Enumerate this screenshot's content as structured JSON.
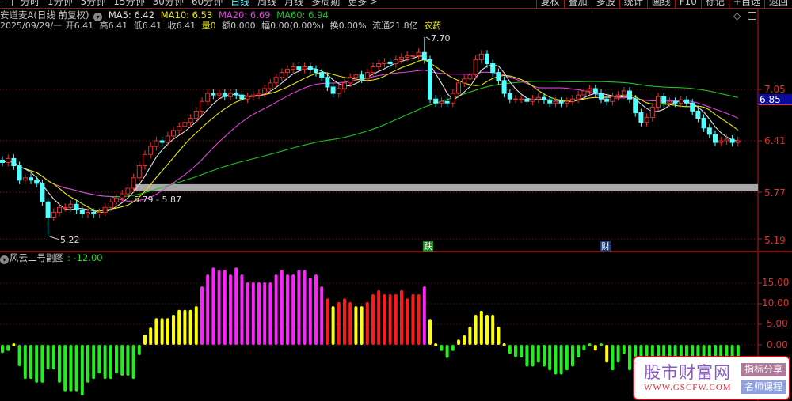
{
  "toolbar": {
    "periods": [
      "分时",
      "1分钟",
      "5分钟",
      "15分钟",
      "30分钟",
      "60分钟",
      "日线",
      "周线",
      "月线",
      "多周期",
      "更多 >"
    ],
    "active_index": 6,
    "buttons": [
      "复权",
      "叠加",
      "多股",
      "统计",
      "画线",
      "F10",
      "标记",
      "+自选",
      "返回"
    ]
  },
  "header": {
    "title": "安道麦A(日线 前复权)",
    "ma5": "MA5: 6.42",
    "ma10": "MA10: 6.53",
    "ma20": "MA20: 6.69",
    "ma60": "MA60: 6.94",
    "date": "2025/09/29/一",
    "open": "开6.41",
    "high": "高6.41",
    "low": "低6.41",
    "close": "收6.41",
    "volume": "量0",
    "amount": "额0.000",
    "range": "幅0.00(0.00%)",
    "turnover": "换0.00%",
    "float": "流通21.8亿",
    "sector": "农药"
  },
  "axis": {
    "price_labels": [
      "7.05",
      "6.41",
      "5.77",
      "5.19"
    ],
    "current_price": "6.85",
    "ind_labels": [
      "15.00",
      "10.00",
      "5.00",
      "0.00"
    ]
  },
  "marks": {
    "high": "7.70",
    "low": "5.22",
    "band": "5.79 - 5.87",
    "down_tag": "跌",
    "fin_tag": "财"
  },
  "sub": {
    "title": "风云二号副图",
    "value": ": -12.00"
  },
  "watermark": {
    "name": "股市财富网",
    "url": "WWW.GSCFW.COM",
    "btn1": "指标分享",
    "btn2": "名师课程"
  },
  "colors": {
    "up": "#e83030",
    "down": "#54ffff",
    "ma5": "#e0e0e0",
    "ma10": "#e8e800",
    "ma20": "#e040e0",
    "ma60": "#20c020",
    "ind_g": "#22ee22",
    "ind_y": "#ffff00",
    "ind_m": "#ff22ff",
    "ind_r": "#ff1a1a"
  },
  "chart_data": {
    "type": "candlestick",
    "ylim": [
      5.1,
      7.75
    ],
    "band": [
      5.79,
      5.87
    ],
    "high_point": {
      "index": 74,
      "value": 7.7
    },
    "low_point": {
      "index": 8,
      "value": 5.22
    },
    "closes": [
      6.14,
      6.19,
      6.1,
      5.92,
      5.95,
      5.92,
      5.88,
      5.65,
      5.46,
      5.52,
      5.58,
      5.58,
      5.62,
      5.55,
      5.5,
      5.52,
      5.5,
      5.52,
      5.58,
      5.65,
      5.7,
      5.75,
      5.82,
      5.95,
      6.1,
      6.24,
      6.34,
      6.41,
      6.39,
      6.47,
      6.54,
      6.59,
      6.64,
      6.69,
      6.78,
      6.9,
      7.0,
      6.98,
      7.0,
      6.96,
      7.0,
      6.98,
      6.93,
      6.96,
      6.98,
      7.0,
      7.06,
      7.13,
      7.2,
      7.26,
      7.3,
      7.33,
      7.3,
      7.33,
      7.3,
      7.26,
      7.2,
      7.08,
      7.0,
      7.06,
      7.13,
      7.2,
      7.23,
      7.18,
      7.26,
      7.33,
      7.37,
      7.39,
      7.37,
      7.42,
      7.45,
      7.47,
      7.47,
      7.51,
      7.42,
      6.93,
      6.88,
      6.9,
      6.88,
      7.0,
      7.13,
      7.18,
      7.23,
      7.42,
      7.49,
      7.37,
      7.26,
      7.16,
      7.0,
      6.93,
      6.93,
      6.93,
      6.9,
      6.93,
      6.95,
      6.92,
      6.88,
      6.9,
      6.88,
      6.9,
      6.93,
      6.98,
      7.03,
      7.06,
      7.0,
      6.93,
      6.9,
      6.96,
      6.98,
      7.03,
      6.93,
      6.76,
      6.64,
      6.7,
      6.83,
      6.96,
      6.88,
      6.9,
      6.88,
      6.92,
      6.88,
      6.78,
      6.69,
      6.57,
      6.49,
      6.39,
      6.41,
      6.43,
      6.39,
      6.41
    ],
    "indicator": {
      "ylim": [
        -14,
        20
      ],
      "values": [
        -2,
        -1.5,
        0.3,
        -5.2,
        -8.3,
        -8.3,
        -9.2,
        -9.2,
        -6,
        -6,
        -9.2,
        -11.3,
        -11.3,
        -11.3,
        -12.3,
        -9.2,
        -8.3,
        -7,
        -8.3,
        -8.3,
        -7,
        -7.5,
        -7.5,
        -8.3,
        -2.5,
        2.5,
        4.2,
        6.5,
        6.5,
        6.5,
        7.3,
        8.5,
        8.5,
        8.5,
        9.4,
        14.2,
        17.1,
        18.8,
        18.2,
        18.2,
        17.1,
        18.8,
        17.1,
        15.2,
        15.2,
        15.2,
        15.2,
        15.2,
        17.1,
        18.2,
        17.1,
        17.1,
        18.2,
        18.2,
        16.3,
        17.1,
        14.2,
        11.3,
        9.4,
        10.4,
        11.3,
        10.4,
        9.4,
        9.4,
        10.4,
        12.3,
        13.3,
        12.3,
        12.3,
        12.3,
        13.3,
        11.3,
        12.3,
        12.3,
        14.2,
        6.3,
        0.3,
        -1.5,
        -3.2,
        -1.5,
        1.3,
        2.3,
        4.4,
        7.3,
        8.3,
        7.3,
        7.3,
        4.4,
        0.3,
        -2.2,
        -3,
        -3.1,
        -5.3,
        -5.3,
        -4.3,
        -5.3,
        -6.2,
        -7.2,
        -7.2,
        -6.2,
        -5.3,
        -3.1,
        -1.4,
        0.3,
        -1.4,
        0.3,
        -4.3,
        -6.2,
        -4.3,
        -2.2,
        -6.2,
        -4,
        -5,
        -4.5,
        -5,
        -4,
        -4.5,
        -5,
        -4,
        -4.5,
        -5,
        -4,
        -4.5,
        -5,
        -5,
        -4,
        -4.5,
        -5,
        -4,
        -3.5
      ],
      "colors": "ggyggggggggggggggggggggggyyyyyyyyyymmmmmmmmmmmmmmmmmmmmmmryrrryyrrrrrrrrrrmyyggg yyyyyyyyygggggggggggggggyg yggggggggggggggggggggggg"
    }
  }
}
